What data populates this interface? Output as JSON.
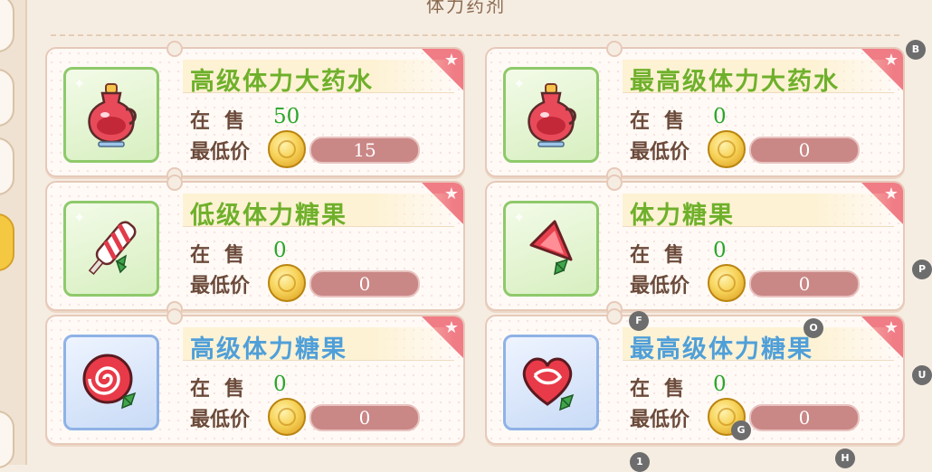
{
  "header": {
    "title": "体力药剂"
  },
  "labels": {
    "on_sale": "在售",
    "min_price": "最低价"
  },
  "cards": [
    {
      "title": "高级体力大药水",
      "on_sale": "50",
      "min_price": "15",
      "title_color": "#6fb02b",
      "frame": "green",
      "item_icon": "potion-icon"
    },
    {
      "title": "最高级体力大药水",
      "on_sale": "0",
      "min_price": "0",
      "title_color": "#6fb02b",
      "frame": "green",
      "item_icon": "potion-icon"
    },
    {
      "title": "低级体力糖果",
      "on_sale": "0",
      "min_price": "0",
      "title_color": "#6fb02b",
      "frame": "green",
      "item_icon": "candy-stick-icon"
    },
    {
      "title": "体力糖果",
      "on_sale": "0",
      "min_price": "0",
      "title_color": "#6fb02b",
      "frame": "green",
      "item_icon": "candy-triangle-icon"
    },
    {
      "title": "高级体力糖果",
      "on_sale": "0",
      "min_price": "0",
      "title_color": "#4f9fd9",
      "frame": "blue",
      "item_icon": "lollipop-round-icon"
    },
    {
      "title": "最高级体力糖果",
      "on_sale": "0",
      "min_price": "0",
      "title_color": "#4f9fd9",
      "frame": "blue",
      "item_icon": "lollipop-heart-icon"
    }
  ],
  "overlay_markers": [
    "B",
    "P",
    "U",
    "F",
    "O",
    "G",
    "1",
    "H"
  ],
  "colors": {
    "accent_green": "#6fb02b",
    "accent_blue": "#4f9fd9",
    "price_pill": "#c98786",
    "corner_ribbon": "#f07c86"
  }
}
